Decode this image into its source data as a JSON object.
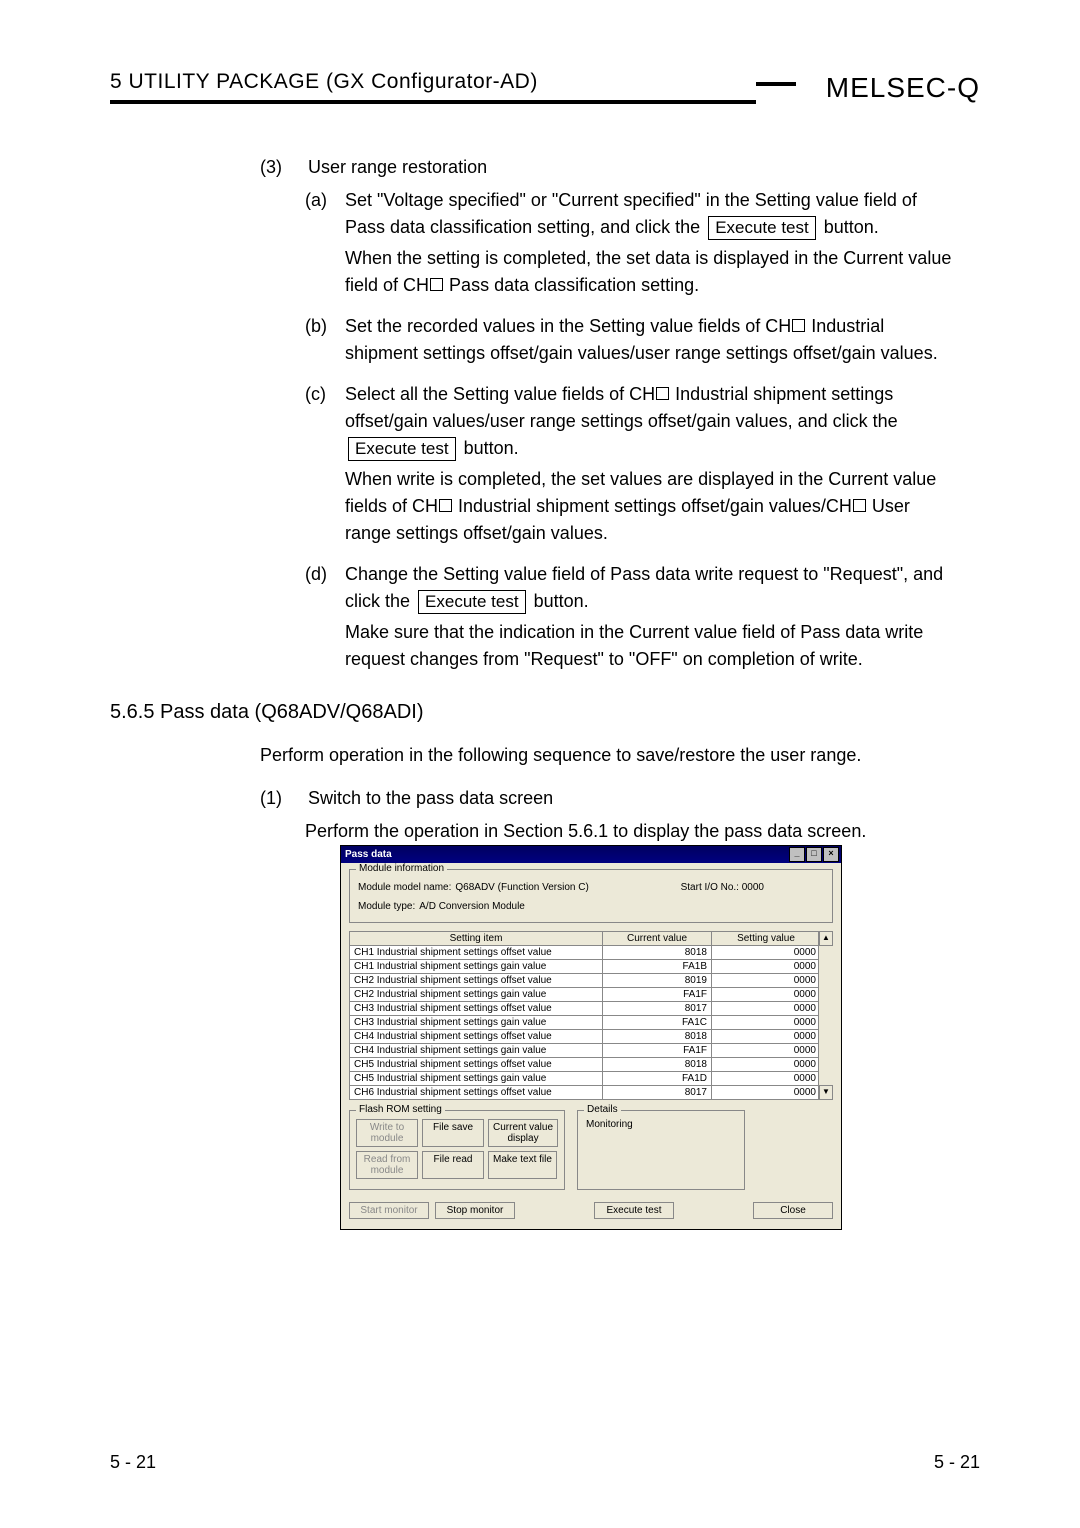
{
  "header": {
    "chapter": "5   UTILITY PACKAGE (GX Configurator-AD)",
    "brand": "MELSEC-Q"
  },
  "sec3": {
    "num": "(3)",
    "title": "User range restoration",
    "items": {
      "a": {
        "lab": "(a)",
        "l1a": "Set \"Voltage specified\" or \"Current specified\" in the Setting value field of",
        "l1b": "Pass data classification setting, and click the ",
        "btn": "Execute test",
        "l1c": " button.",
        "l2a": "When the setting is completed, the set data is displayed in the Current value",
        "l2b_a": "field of CH",
        "l2b_b": " Pass data classification setting."
      },
      "b": {
        "lab": "(b)",
        "l1a_a": "Set the recorded values in the Setting value fields of CH",
        "l1a_b": " Industrial",
        "l1b": "shipment settings offset/gain values/user range settings offset/gain values."
      },
      "c": {
        "lab": "(c)",
        "l1a_a": "Select all the Setting value fields of CH",
        "l1a_b": " Industrial shipment settings",
        "l1b": "offset/gain values/user range settings offset/gain values, and click the",
        "btn": "Execute test",
        "l1c": " button.",
        "l2a": "When write is completed, the set values are displayed in the Current value",
        "l2b_a": "fields of CH",
        "l2b_b": " Industrial shipment settings offset/gain values/CH",
        "l2b_c": " User",
        "l2c": "range settings offset/gain values."
      },
      "d": {
        "lab": "(d)",
        "l1a": "Change the Setting value field of Pass data write request to \"Request\", and",
        "l1b_a": "click the ",
        "btn": "Execute test",
        "l1b_b": " button.",
        "l2a": "Make sure that the indication in the Current value field of Pass data write",
        "l2b": "request changes from \"Request\" to \"OFF\" on completion of write."
      }
    }
  },
  "sec565": {
    "heading": "5.6.5 Pass data (Q68ADV/Q68ADI)",
    "intro": "Perform operation in the following sequence to save/restore the user range.",
    "s1_num": "(1)",
    "s1_title": "Switch to the pass data screen",
    "s1_body": "Perform the operation in Section 5.6.1 to display the pass data screen."
  },
  "dialog": {
    "title": "Pass data",
    "min": "_",
    "max": "□",
    "close": "×",
    "moduleInfoTitle": "Module information",
    "modName_l": "Module model name:",
    "modName_v": "Q68ADV (Function Version C)",
    "startIO_l": "Start I/O No.:",
    "startIO_v": "0000",
    "modType_l": "Module type:",
    "modType_v": "A/D Conversion Module",
    "th_item": "Setting item",
    "th_cv": "Current value",
    "th_sv": "Setting value",
    "rows": [
      {
        "item": "CH1 Industrial shipment settings offset value",
        "cv": "8018",
        "sv": "0000"
      },
      {
        "item": "CH1 Industrial shipment settings gain value",
        "cv": "FA1B",
        "sv": "0000"
      },
      {
        "item": "CH2 Industrial shipment settings offset value",
        "cv": "8019",
        "sv": "0000"
      },
      {
        "item": "CH2 Industrial shipment settings gain value",
        "cv": "FA1F",
        "sv": "0000"
      },
      {
        "item": "CH3 Industrial shipment settings offset value",
        "cv": "8017",
        "sv": "0000"
      },
      {
        "item": "CH3 Industrial shipment settings gain value",
        "cv": "FA1C",
        "sv": "0000"
      },
      {
        "item": "CH4 Industrial shipment settings offset value",
        "cv": "8018",
        "sv": "0000"
      },
      {
        "item": "CH4 Industrial shipment settings gain value",
        "cv": "FA1F",
        "sv": "0000"
      },
      {
        "item": "CH5 Industrial shipment settings offset value",
        "cv": "8018",
        "sv": "0000"
      },
      {
        "item": "CH5 Industrial shipment settings gain value",
        "cv": "FA1D",
        "sv": "0000"
      },
      {
        "item": "CH6 Industrial shipment settings offset value",
        "cv": "8017",
        "sv": "0000"
      }
    ],
    "scroll_up": "▲",
    "scroll_down": "▼",
    "flashTitle": "Flash ROM setting",
    "btn_write": "Write to\nmodule",
    "btn_fsave": "File save",
    "btn_cvd": "Current value\ndisplay",
    "btn_read": "Read from\nmodule",
    "btn_fread": "File read",
    "btn_mtf": "Make text file",
    "detailsTitle": "Details",
    "details_val": "Monitoring",
    "btn_start": "Start monitor",
    "btn_stop": "Stop monitor",
    "btn_exec": "Execute test",
    "btn_close": "Close"
  },
  "footer": {
    "left": "5 - 21",
    "right": "5 - 21"
  }
}
